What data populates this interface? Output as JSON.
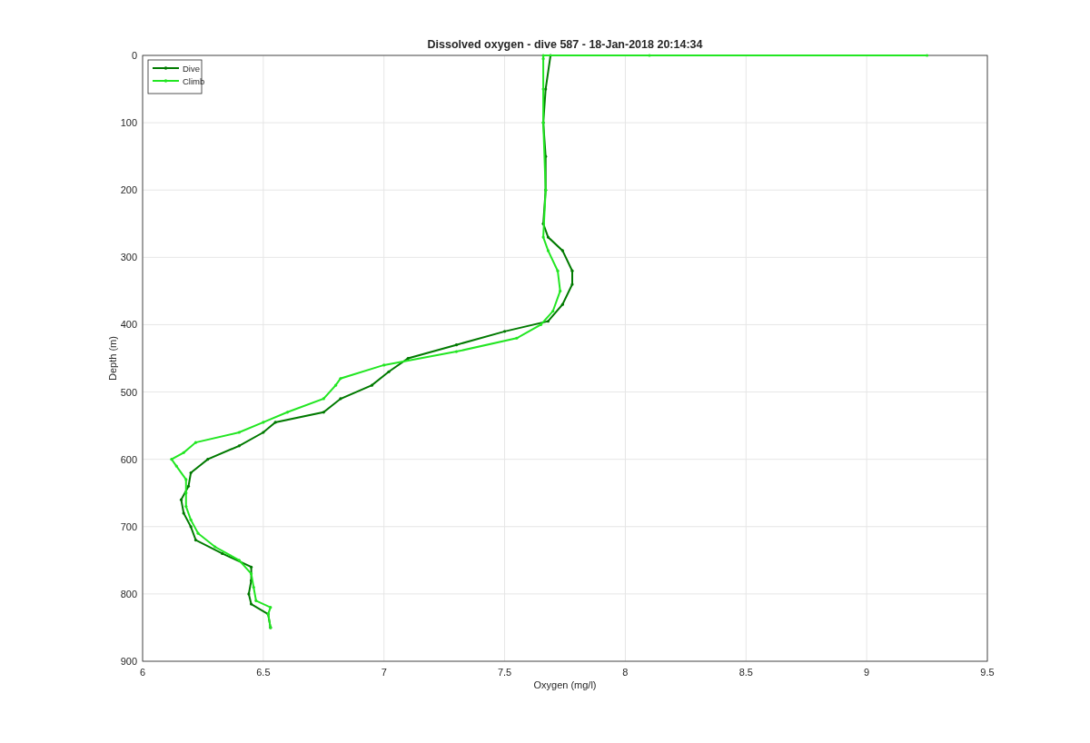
{
  "chart_data": {
    "type": "line",
    "title": "Dissolved oxygen - dive 587 - 18-Jan-2018 20:14:34",
    "xlabel": "Oxygen (mg/l)",
    "ylabel": "Depth (m)",
    "xlim": [
      6,
      9.5
    ],
    "ylim": [
      900,
      0
    ],
    "xticks": [
      6,
      6.5,
      7,
      7.5,
      8,
      8.5,
      9,
      9.5
    ],
    "yticks": [
      0,
      100,
      200,
      300,
      400,
      500,
      600,
      700,
      800,
      900
    ],
    "grid": true,
    "legend": "top-left",
    "series": [
      {
        "name": "Dive",
        "color": "#007a00",
        "x": [
          7.69,
          7.67,
          7.66,
          7.67,
          7.67,
          7.66,
          7.68,
          7.74,
          7.78,
          7.78,
          7.74,
          7.68,
          7.5,
          7.3,
          7.1,
          7.02,
          6.95,
          6.82,
          6.75,
          6.55,
          6.5,
          6.4,
          6.27,
          6.2,
          6.19,
          6.16,
          6.17,
          6.2,
          6.22,
          6.33,
          6.45,
          6.45,
          6.44,
          6.45,
          6.52,
          6.53
        ],
        "values": [
          0,
          50,
          100,
          150,
          200,
          250,
          270,
          290,
          320,
          340,
          370,
          395,
          410,
          430,
          450,
          470,
          490,
          510,
          530,
          545,
          560,
          580,
          600,
          620,
          640,
          660,
          680,
          700,
          720,
          740,
          760,
          780,
          800,
          815,
          830,
          850
        ]
      },
      {
        "name": "Climb",
        "color": "#22e622",
        "x": [
          6.53,
          6.52,
          6.53,
          6.47,
          6.46,
          6.45,
          6.4,
          6.3,
          6.23,
          6.2,
          6.18,
          6.18,
          6.18,
          6.14,
          6.12,
          6.17,
          6.22,
          6.4,
          6.5,
          6.6,
          6.75,
          6.8,
          6.82,
          7.0,
          7.3,
          7.55,
          7.65,
          7.7,
          7.73,
          7.72,
          7.68,
          7.66,
          7.67,
          7.66,
          7.66,
          7.66,
          7.66,
          8.1,
          9.25
        ],
        "values": [
          850,
          830,
          820,
          810,
          790,
          770,
          750,
          730,
          710,
          690,
          670,
          650,
          630,
          610,
          600,
          590,
          575,
          560,
          545,
          530,
          510,
          490,
          480,
          460,
          440,
          420,
          400,
          380,
          350,
          320,
          290,
          270,
          200,
          100,
          50,
          5,
          0,
          0,
          0
        ]
      }
    ]
  }
}
